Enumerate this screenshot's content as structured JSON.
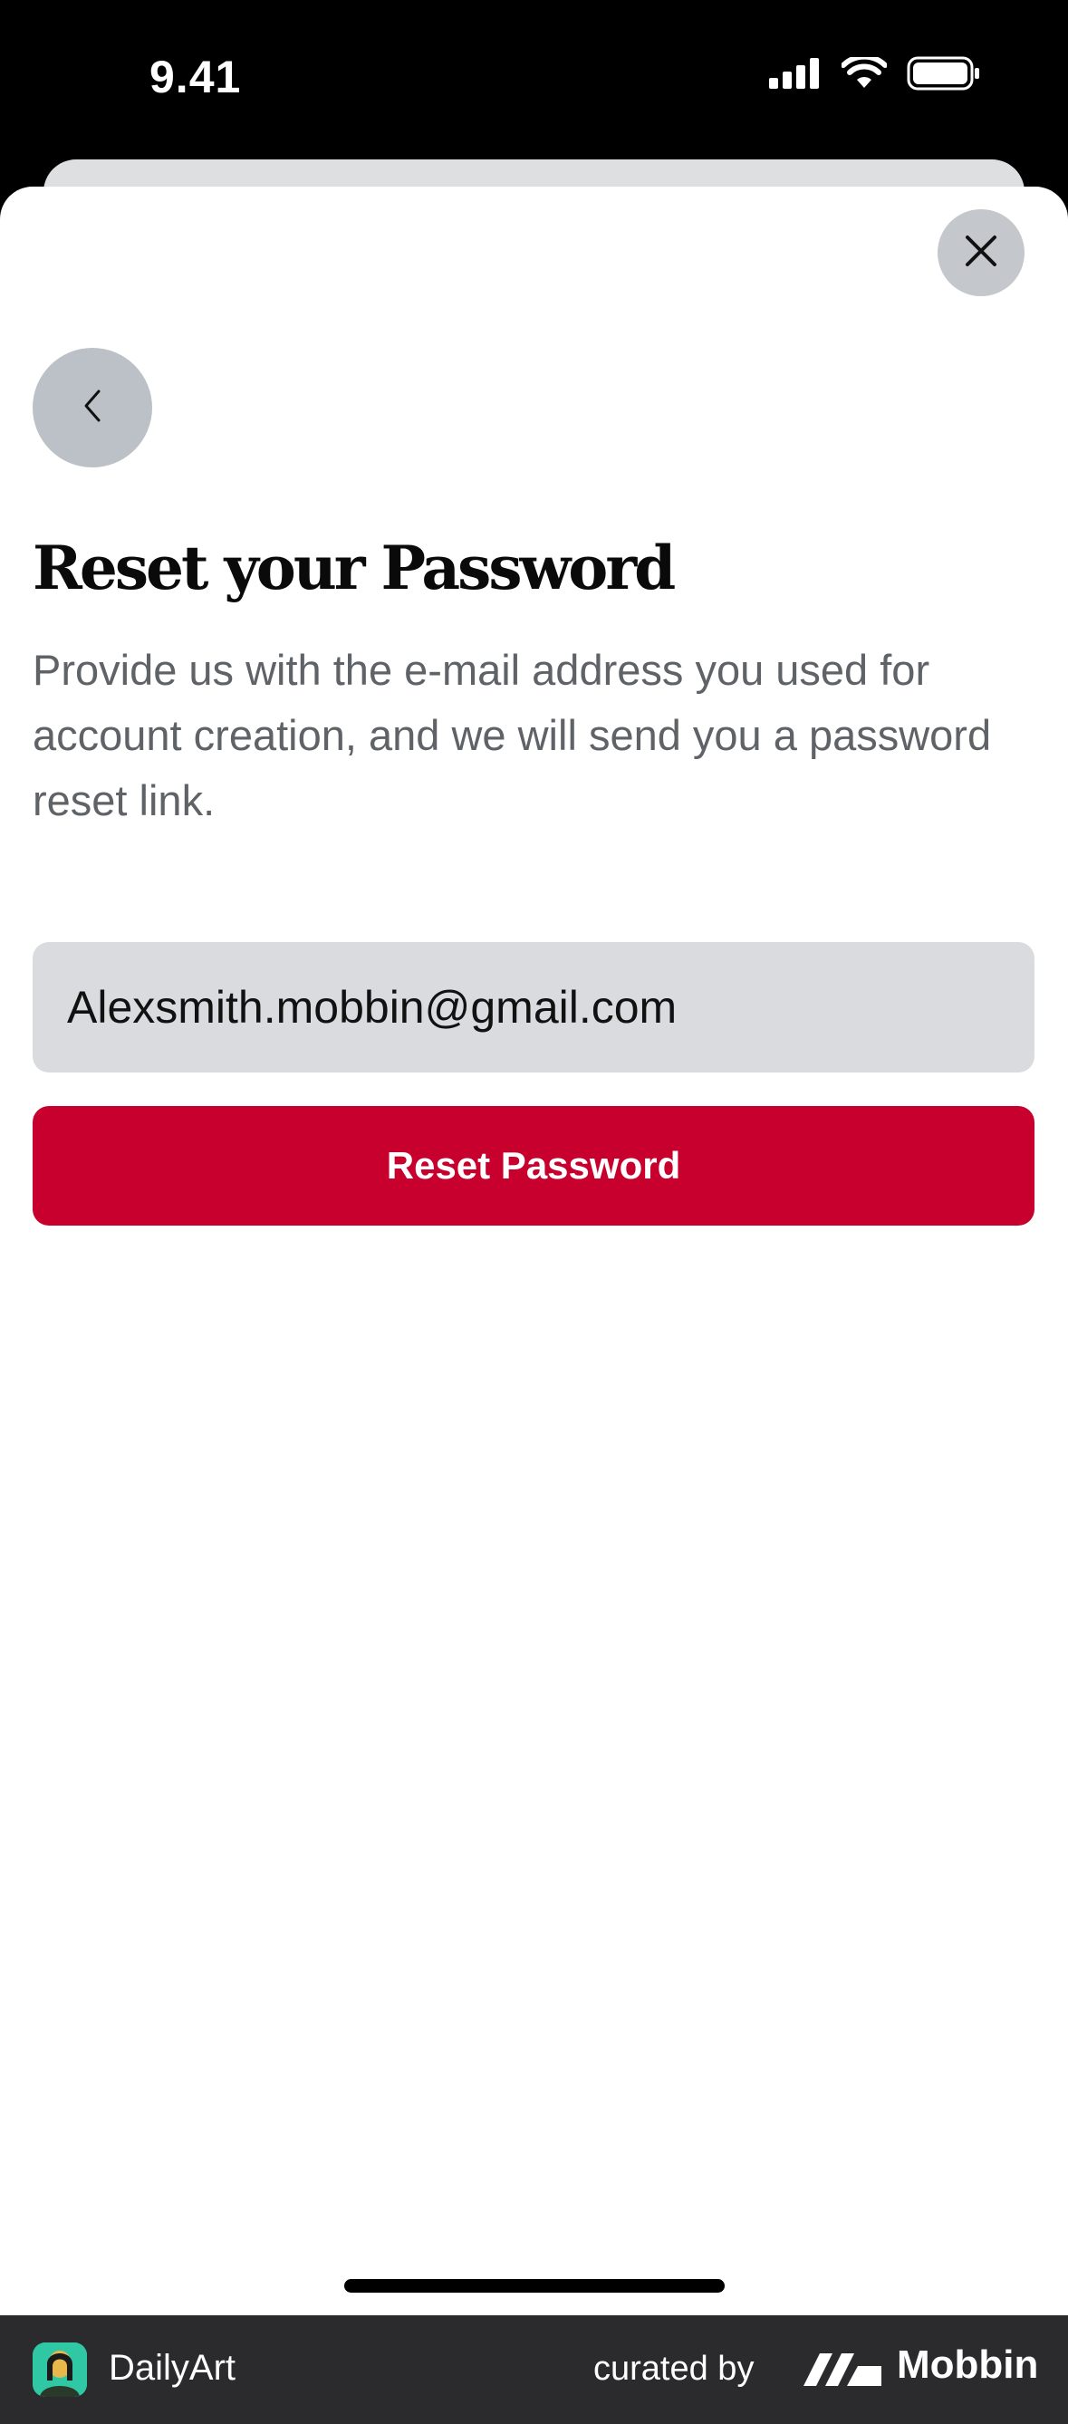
{
  "status_bar": {
    "time": "9.41",
    "icons": [
      "cellular-signal-icon",
      "wifi-icon",
      "battery-icon"
    ]
  },
  "sheet": {
    "close_icon": "close-icon",
    "back_icon": "chevron-left-icon"
  },
  "content": {
    "title": "Reset your Password",
    "description": "Provide us with the e-mail address you used for account creation, and we will send you a password reset link.",
    "email_value": "Alexsmith.mobbin@gmail.com",
    "submit_label": "Reset Password"
  },
  "footer": {
    "app_name": "DailyArt",
    "curated_label": "curated by",
    "brand_name": "Mobbin"
  },
  "colors": {
    "accent": "#c8002d",
    "field_bg": "#d9dbdf",
    "button_circle_bg": "#bcc1c7"
  }
}
